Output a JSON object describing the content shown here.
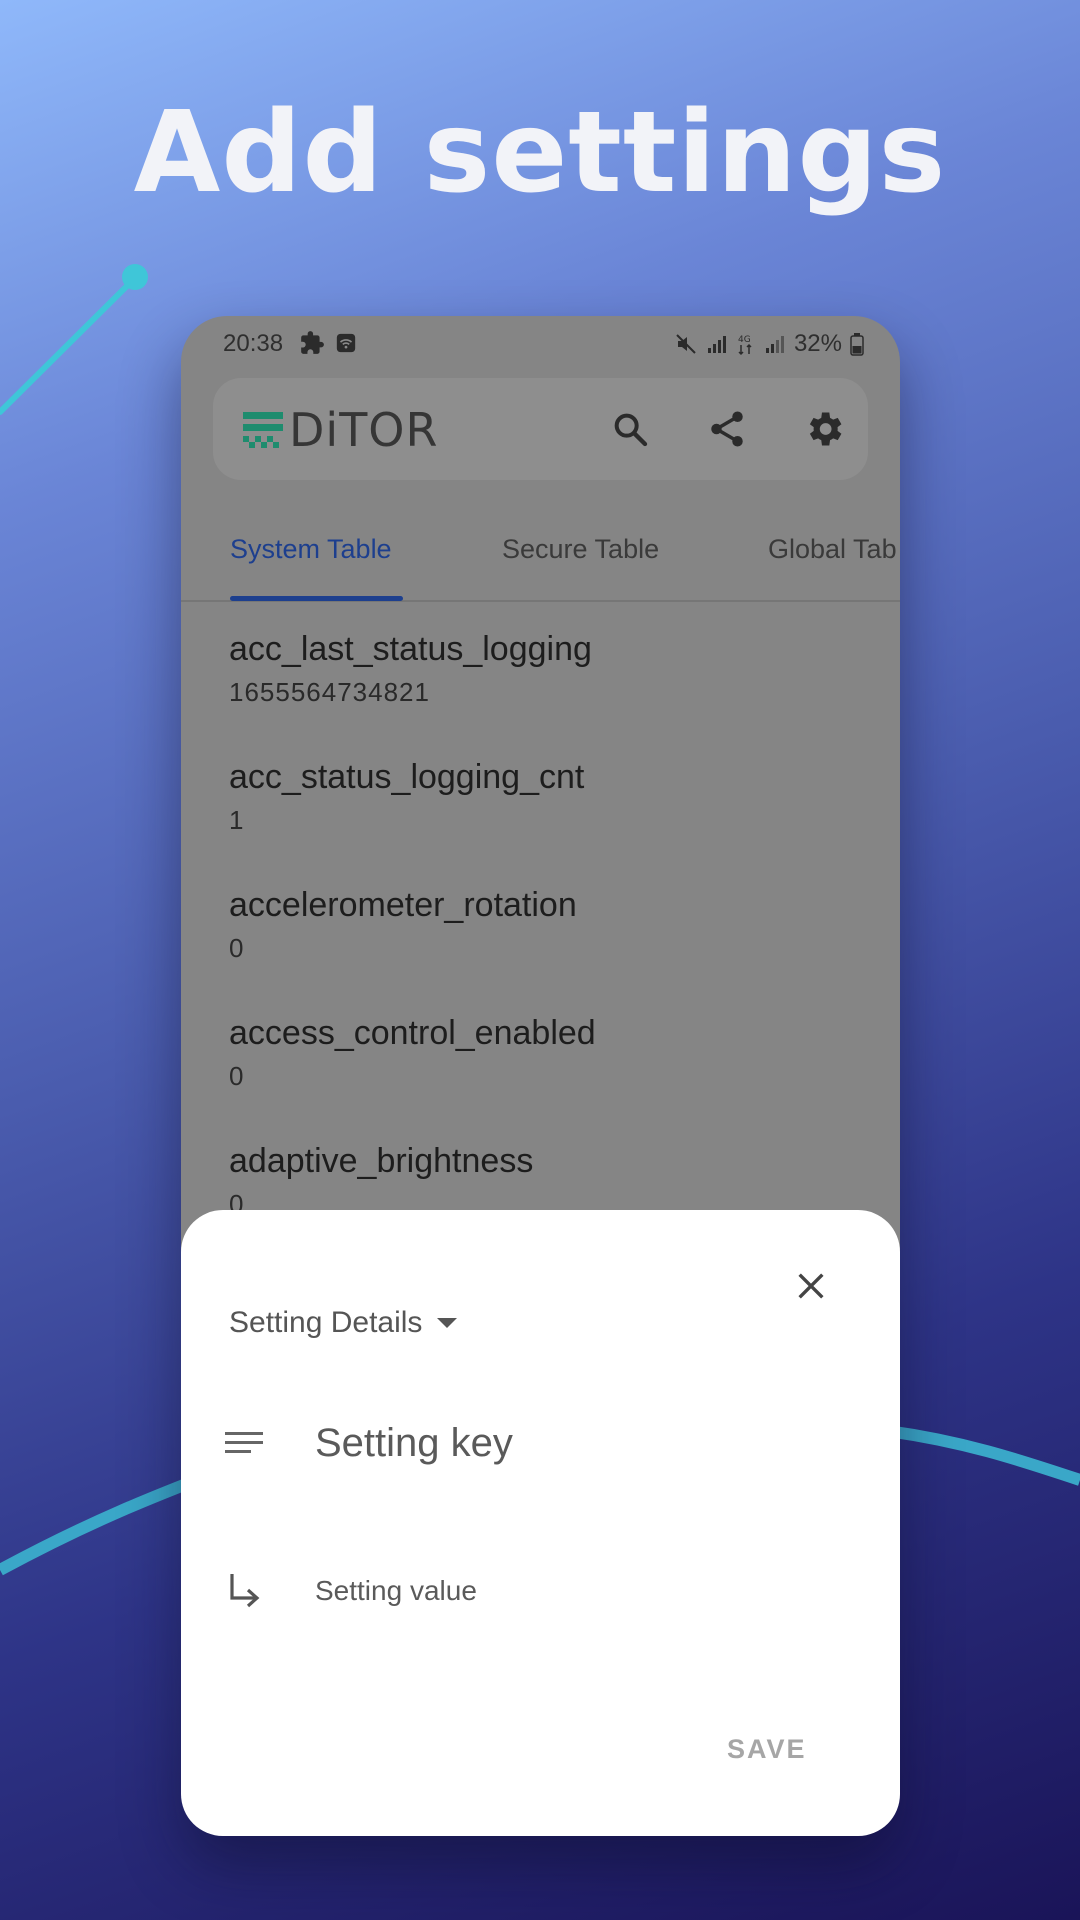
{
  "headline": "Add settings",
  "status_bar": {
    "time": "20:38",
    "battery_percent": "32%",
    "icons": [
      "puzzle-icon",
      "wifi-icon",
      "mute-icon",
      "signal-icon",
      "4g-icon",
      "signal-icon",
      "battery-icon"
    ]
  },
  "app_bar": {
    "logo_text": "DiTOR",
    "actions": [
      "search-icon",
      "share-icon",
      "settings-gear-icon"
    ]
  },
  "tabs": [
    {
      "label": "System Table",
      "active": true
    },
    {
      "label": "Secure Table",
      "active": false
    },
    {
      "label": "Global Tab",
      "active": false
    }
  ],
  "settings_list": [
    {
      "key": "acc_last_status_logging",
      "value": "1655564734821"
    },
    {
      "key": "acc_status_logging_cnt",
      "value": "1"
    },
    {
      "key": "accelerometer_rotation",
      "value": "0"
    },
    {
      "key": "access_control_enabled",
      "value": "0"
    },
    {
      "key": "adaptive_brightness",
      "value": "0"
    }
  ],
  "sheet": {
    "title": "Setting Details",
    "key_placeholder": "Setting key",
    "value_placeholder": "Setting value",
    "save_label": "SAVE"
  },
  "colors": {
    "accent_tab": "#1d3f8e",
    "logo_green": "#1e8c6e",
    "decor_line": "#3fc6d8"
  }
}
